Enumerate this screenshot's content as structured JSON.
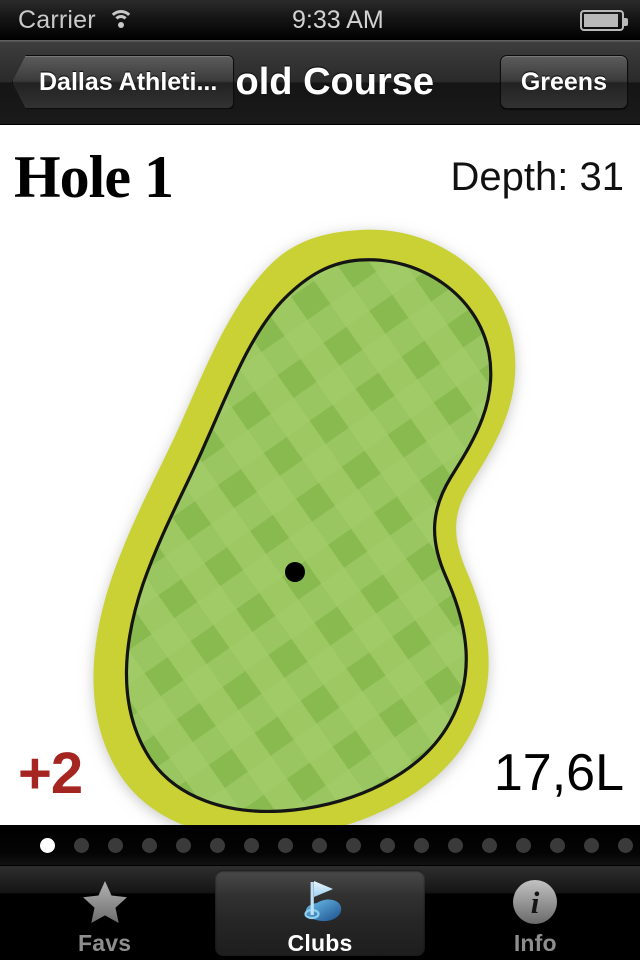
{
  "statusbar": {
    "carrier": "Carrier",
    "time": "9:33 AM",
    "wifi_icon": "wifi-icon",
    "battery_icon": "battery-icon"
  },
  "navbar": {
    "back_label": "Dallas Athleti...",
    "title": "Gold Course",
    "right_label": "Greens"
  },
  "hole": {
    "title": "Hole 1",
    "depth": "Depth: 31",
    "score": "+2",
    "distance": "17,6L"
  },
  "green_graphic": {
    "fringe_color": "#c9d134",
    "surface_color": "#8cbd52",
    "surface_light": "#a4cd6b",
    "outline_color": "#141414",
    "pin_color": "#000000",
    "pin_label": "pin-position",
    "shape": "kidney"
  },
  "pager": {
    "total": 18,
    "current": 1,
    "active_color": "#ffffff",
    "inactive_color": "#3a3a3a"
  },
  "tabbar": {
    "tabs": [
      {
        "label": "Favs",
        "icon": "star-icon",
        "selected": false
      },
      {
        "label": "Clubs",
        "icon": "golf-flag-icon",
        "selected": true
      },
      {
        "label": "Info",
        "icon": "info-circle-icon",
        "selected": false
      }
    ]
  },
  "colors": {
    "score_red": "#a52521",
    "background": "#ffffff",
    "chrome": "#1a1a1a"
  }
}
